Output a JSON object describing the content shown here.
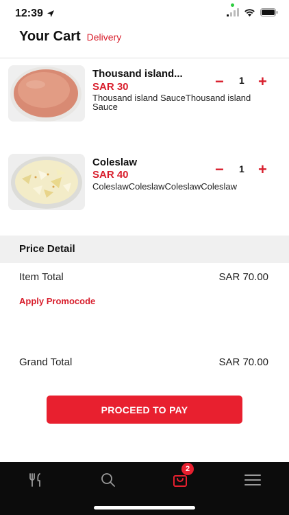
{
  "status": {
    "time": "12:39",
    "icons": [
      "location-arrow-icon",
      "cellular-signal-icon",
      "wifi-icon",
      "battery-icon"
    ]
  },
  "header": {
    "title": "Your Cart",
    "subtitle": "Delivery"
  },
  "cart": {
    "items": [
      {
        "name": "Thousand island...",
        "price": "SAR 30",
        "description": "Thousand island SauceThousand island Sauce",
        "quantity": "1",
        "minus": "−",
        "plus": "+",
        "image": "thousand-island-sauce-image"
      },
      {
        "name": "Coleslaw",
        "price": "SAR 40",
        "description": "ColeslawColeslawColeslawColeslaw",
        "quantity": "1",
        "minus": "−",
        "plus": "+",
        "image": "coleslaw-image"
      }
    ]
  },
  "price_detail": {
    "title": "Price Detail",
    "item_total_label": "Item Total",
    "item_total_value": "SAR 70.00",
    "promo_label": "Apply Promocode",
    "grand_total_label": "Grand Total",
    "grand_total_value": "SAR 70.00"
  },
  "actions": {
    "pay_label": "PROCEED TO PAY"
  },
  "bottom_nav": {
    "items": [
      {
        "icon": "menu-utensils-icon"
      },
      {
        "icon": "search-icon"
      },
      {
        "icon": "cart-bag-icon",
        "badge": "2",
        "active": true
      },
      {
        "icon": "hamburger-menu-icon"
      }
    ]
  },
  "colors": {
    "accent": "#e8202f",
    "accent_text": "#d81e2c",
    "nav_background": "#0c0c0c",
    "nav_active": "#e8202f",
    "nav_inactive": "#9a9a9a"
  }
}
